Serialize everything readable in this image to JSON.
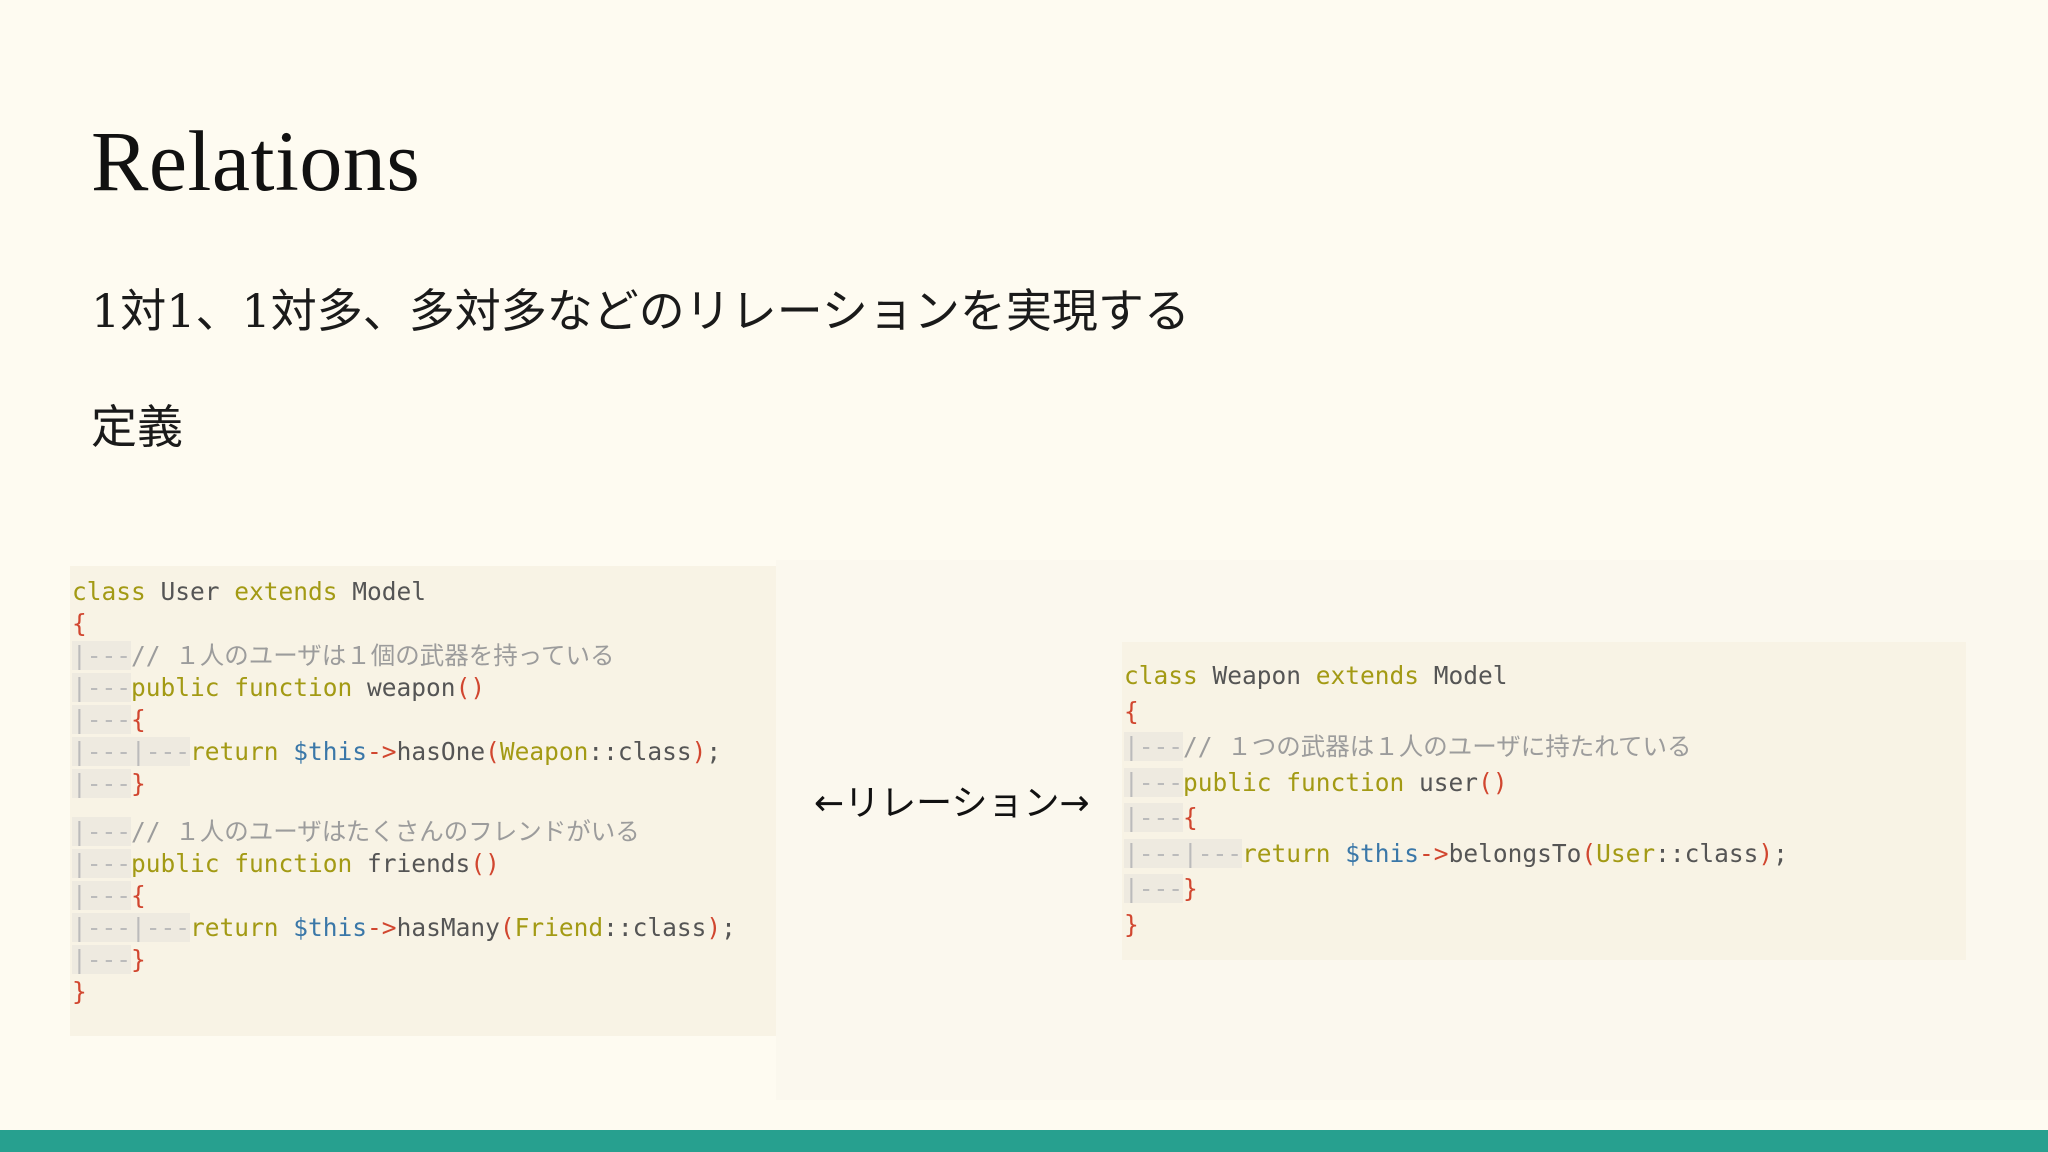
{
  "slide": {
    "title": "Relations",
    "subtitle": "1対1、1対多、多対多などのリレーションを実現する",
    "definition_label": "定義",
    "relation_label": "←リレーション→"
  },
  "code_user": {
    "l1_kw1": "class",
    "l1_name": " User ",
    "l1_kw2": "extends",
    "l1_base": " Model",
    "open": "{",
    "close": "}",
    "guide": "|---",
    "guide2": "|---|---",
    "comment1": "// １人のユーザは１個の武器を持っている",
    "kw_public": "public",
    "kw_function": " function ",
    "fn1": "weapon",
    "parens": "()",
    "ret": "return ",
    "this": "$this",
    "op": "->",
    "call1": "hasOne",
    "lp": "(",
    "arg1": "Weapon",
    "sep": "::",
    "classkw": "class",
    "rp": ")",
    "semi": ";",
    "comment2": "// １人のユーザはたくさんのフレンドがいる",
    "fn2": "friends",
    "call2": "hasMany",
    "arg2": "Friend"
  },
  "code_weapon": {
    "l1_kw1": "class",
    "l1_name": " Weapon ",
    "l1_kw2": "extends",
    "l1_base": " Model",
    "comment1": "// １つの武器は１人のユーザに持たれている",
    "fn1": "user",
    "call1": "belongsTo",
    "arg1": "User"
  },
  "colors": {
    "background": "#fefbf1",
    "accent_bar": "#27a08f",
    "keyword": "#a39a14",
    "brace": "#d1462f",
    "variable": "#3a77a8"
  }
}
